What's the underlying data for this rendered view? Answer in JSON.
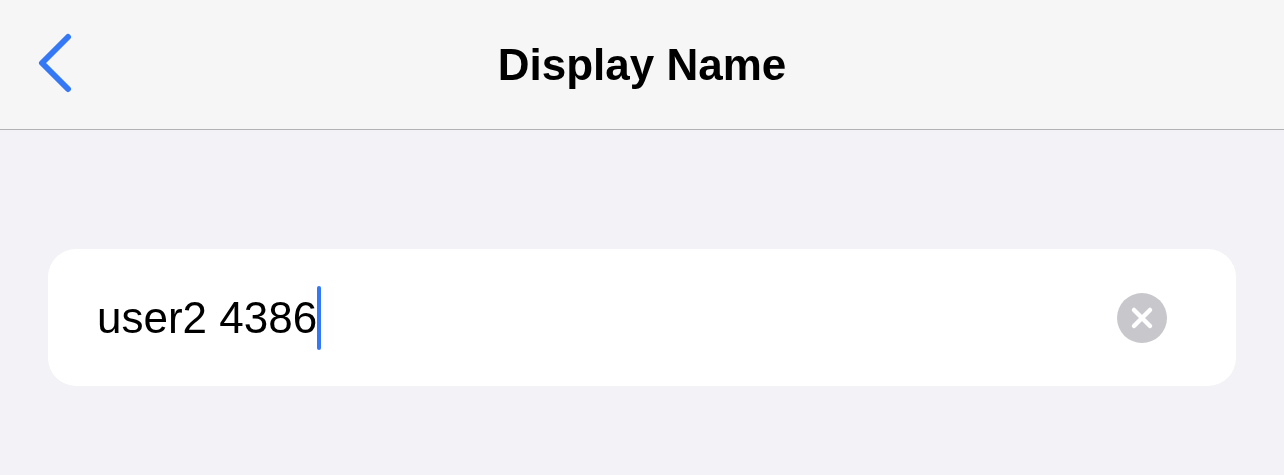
{
  "nav_bar": {
    "title": "Display Name"
  },
  "field": {
    "value": "user2 4386",
    "focused": true
  }
}
